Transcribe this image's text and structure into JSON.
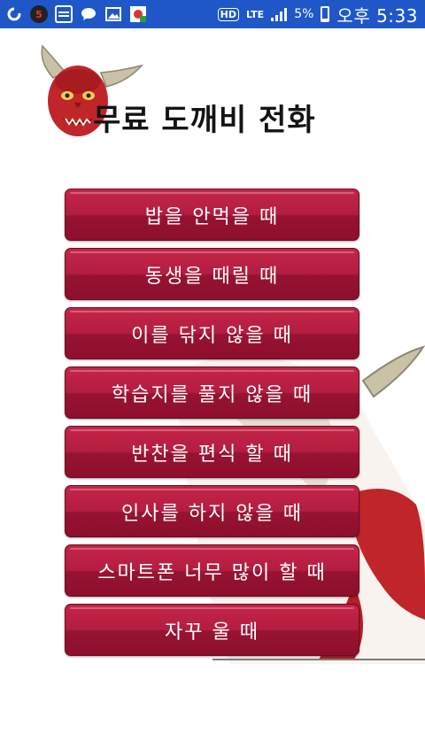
{
  "status_bar": {
    "notif_icons": [
      "sync-icon",
      "badge-5-icon",
      "message-icon",
      "chat-icon",
      "image-icon",
      "security-icon"
    ],
    "badge_number": "5",
    "hd": "HD",
    "network": "LTE",
    "battery_percent": "5%",
    "time": "오후 5:33"
  },
  "header": {
    "title": "무료 도깨비 전화"
  },
  "menu": {
    "items": [
      {
        "label": "밥을 안먹을 때"
      },
      {
        "label": "동생을 때릴 때"
      },
      {
        "label": "이를 닦지 않을 때"
      },
      {
        "label": "학습지를 풀지 않을 때"
      },
      {
        "label": "반찬을 편식 할 때"
      },
      {
        "label": "인사를 하지 않을 때"
      },
      {
        "label": "스마트폰 너무 많이 할 때"
      },
      {
        "label": "자꾸 울 때"
      }
    ]
  },
  "colors": {
    "status_bar": "#1f57c8",
    "button": "#a8183b",
    "goblin_red": "#c0252a"
  }
}
